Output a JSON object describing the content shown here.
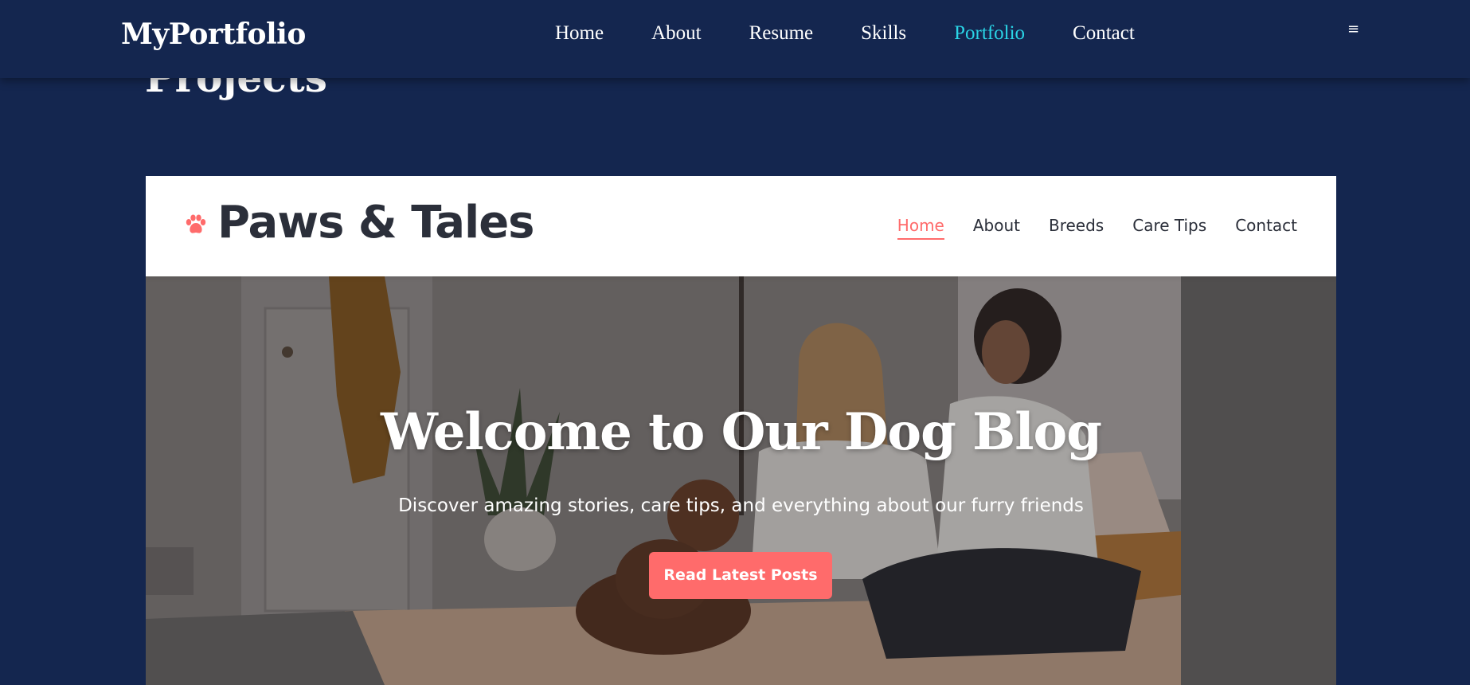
{
  "portfolio": {
    "brand": "MyPortfolio",
    "nav": [
      {
        "label": "Home",
        "active": false
      },
      {
        "label": "About",
        "active": false
      },
      {
        "label": "Resume",
        "active": false
      },
      {
        "label": "Skills",
        "active": false
      },
      {
        "label": "Portfolio",
        "active": true
      },
      {
        "label": "Contact",
        "active": false
      }
    ],
    "menu_icon": "hamburger-icon",
    "section_title": "Projects"
  },
  "project": {
    "logo_icon": "paw-icon",
    "title": "Paws & Tales",
    "nav": [
      {
        "label": "Home",
        "active": true
      },
      {
        "label": "About",
        "active": false
      },
      {
        "label": "Breeds",
        "active": false
      },
      {
        "label": "Care Tips",
        "active": false
      },
      {
        "label": "Contact",
        "active": false
      }
    ],
    "hero": {
      "title": "Welcome to Our Dog Blog",
      "subtitle": "Discover amazing stories, care tips, and everything about our furry friends",
      "button": "Read Latest Posts"
    }
  },
  "colors": {
    "page_bg": "#14264f",
    "active_nav": "#2ad4e6",
    "accent": "#ff6b6b",
    "dark_text": "#2b2f3a"
  }
}
